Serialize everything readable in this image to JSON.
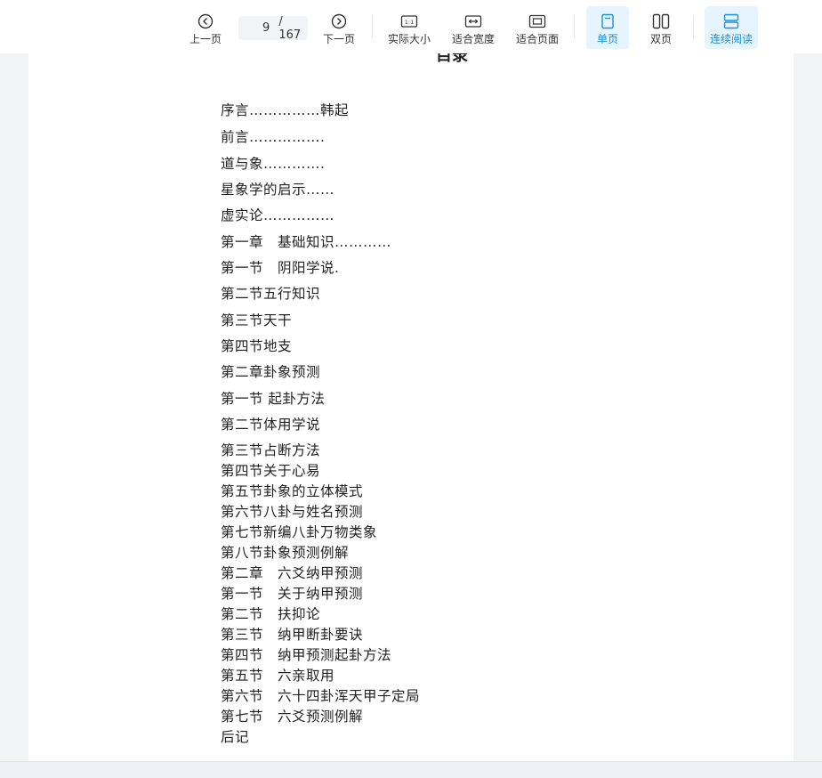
{
  "toolbar": {
    "prev_label": "上一页",
    "page_current": "9",
    "page_total": "/ 167",
    "next_label": "下一页",
    "actual_size_label": "实际大小",
    "fit_width_label": "适合宽度",
    "fit_page_label": "适合页面",
    "single_page_label": "单页",
    "double_page_label": "双页",
    "continuous_label": "连续阅读",
    "accent_color": "#1e90d6",
    "icons": [
      "chevron-left-icon",
      "chevron-right-icon",
      "actual-size-icon",
      "fit-width-icon",
      "fit-page-icon",
      "single-page-icon",
      "double-page-icon",
      "continuous-icon"
    ]
  },
  "document": {
    "heading": "目录",
    "toc": [
      "序言……………韩起",
      "前言…………….",
      "道与象………….",
      "星象学的启示……",
      "虚实论……………",
      "第一章　基础知识…………",
      "第一节　阴阳学说.",
      "第二节五行知识",
      "第三节天干",
      "第四节地支",
      "第二章卦象预测",
      "第一节 起卦方法",
      "第二节体用学说",
      "第三节占断方法",
      "第四节关于心易",
      "第五节卦象的立体模式",
      "第六节八卦与姓名预测",
      "第七节新编八卦万物类象",
      "第八节卦象预测例解",
      "第二章　六爻纳甲预测",
      "第一节　关于纳甲预测",
      "第二节　扶抑论",
      "第三节　纳甲断卦要诀",
      "第四节　纳甲预测起卦方法",
      "第五节　六亲取用",
      "第六节　六十四卦浑天甲子定局",
      "第七节　六爻预测例解",
      "后记"
    ]
  }
}
